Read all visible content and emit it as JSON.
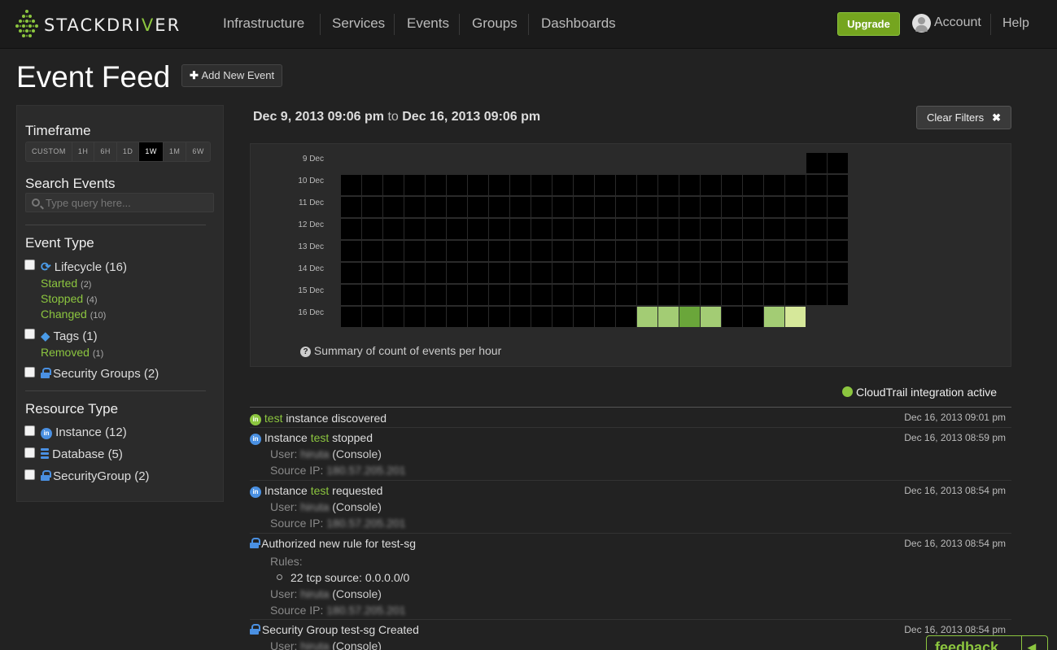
{
  "brand": {
    "name_pre": "STACKDRI",
    "name_v": "V",
    "name_post": "ER"
  },
  "nav": [
    {
      "label": "Infrastructure"
    },
    {
      "label": "Services"
    },
    {
      "label": "Events"
    },
    {
      "label": "Groups"
    },
    {
      "label": "Dashboards"
    }
  ],
  "header_right": {
    "upgrade": "Upgrade",
    "account": "Account",
    "help": "Help"
  },
  "page": {
    "title": "Event Feed",
    "add_button": "Add New Event"
  },
  "sidebar": {
    "timeframe": {
      "heading": "Timeframe",
      "options": [
        "CUSTOM",
        "1H",
        "6H",
        "1D",
        "1W",
        "1M",
        "6W"
      ],
      "selected": "1W"
    },
    "search": {
      "heading": "Search Events",
      "placeholder": "Type query here..."
    },
    "event_type": {
      "heading": "Event Type",
      "lifecycle": {
        "label": "Lifecycle",
        "count": "(16)",
        "icon": "refresh-icon",
        "subs": [
          {
            "label": "Started",
            "count": "(2)"
          },
          {
            "label": "Stopped",
            "count": "(4)"
          },
          {
            "label": "Changed",
            "count": "(10)"
          }
        ]
      },
      "tags": {
        "label": "Tags",
        "count": "(1)",
        "icon": "tag-icon",
        "subs": [
          {
            "label": "Removed",
            "count": "(1)"
          }
        ]
      },
      "security_groups": {
        "label": "Security Groups",
        "count": "(2)",
        "icon": "lock-icon"
      }
    },
    "resource_type": {
      "heading": "Resource Type",
      "items": [
        {
          "label": "Instance",
          "count": "(12)",
          "icon": "instance-icon"
        },
        {
          "label": "Database",
          "count": "(5)",
          "icon": "database-icon"
        },
        {
          "label": "SecurityGroup",
          "count": "(2)",
          "icon": "lock-icon"
        }
      ]
    }
  },
  "range": {
    "from": "Dec 9, 2013 09:06 pm",
    "to_word": "to",
    "to": "Dec 16, 2013 09:06 pm"
  },
  "clear_filters": "Clear Filters",
  "heatmap": {
    "days": [
      "9 Dec",
      "10 Dec",
      "11 Dec",
      "12 Dec",
      "13 Dec",
      "14 Dec",
      "15 Dec",
      "16 Dec"
    ],
    "hours_per_row": 24,
    "first_row_start_hour": 22,
    "last_row_end_hour": 22,
    "colors": {
      "empty": "#000000",
      "low": "#a3cc74",
      "mid": "#6aa63a",
      "high": "#d6e89a"
    },
    "active_cells": [
      {
        "day": "16 Dec",
        "hour": 14,
        "level": "low"
      },
      {
        "day": "16 Dec",
        "hour": 15,
        "level": "low"
      },
      {
        "day": "16 Dec",
        "hour": 16,
        "level": "mid"
      },
      {
        "day": "16 Dec",
        "hour": 17,
        "level": "low"
      },
      {
        "day": "16 Dec",
        "hour": 20,
        "level": "low"
      },
      {
        "day": "16 Dec",
        "hour": 21,
        "level": "high"
      }
    ],
    "caption": "Summary of count of events per hour"
  },
  "cloudtrail": "CloudTrail integration active",
  "feed": {
    "e1": {
      "hl": "test",
      "rest": " instance discovered",
      "time": "Dec 16, 2013 09:01 pm"
    },
    "e2": {
      "pre": "Instance ",
      "hl": "test",
      "rest": " stopped",
      "time": "Dec 16, 2013 08:59 pm",
      "user_label": "User:",
      "user": "hiruta",
      "via": "(Console)",
      "ip_label": "Source IP:",
      "ip": "180.57.205.201"
    },
    "e3": {
      "pre": "Instance ",
      "hl": "test",
      "rest": " requested",
      "time": "Dec 16, 2013 08:54 pm",
      "user_label": "User:",
      "user": "hiruta",
      "via": "(Console)",
      "ip_label": "Source IP:",
      "ip": "180.57.205.201"
    },
    "e4": {
      "title": "Authorized new rule for test-sg",
      "time": "Dec 16, 2013 08:54 pm",
      "rules_label": "Rules:",
      "rule": "22 tcp source: 0.0.0.0/0",
      "user_label": "User:",
      "user": "hiruta",
      "via": "(Console)",
      "ip_label": "Source IP:",
      "ip": "180.57.205.201"
    },
    "e5": {
      "title": "Security Group test-sg Created",
      "time": "Dec 16, 2013 08:54 pm",
      "user_label": "User:",
      "user": "hiruta",
      "via": "(Console)"
    }
  },
  "feedback": "feedback"
}
